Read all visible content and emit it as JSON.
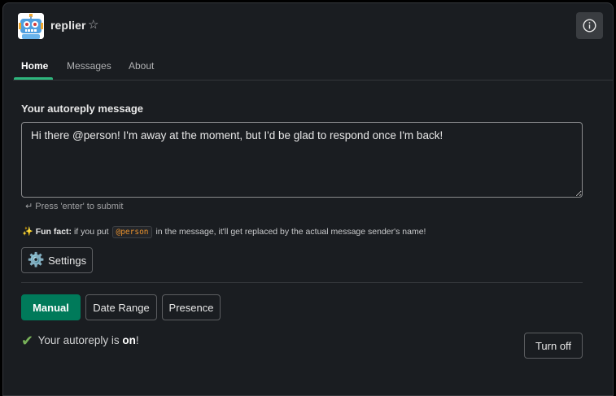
{
  "app": {
    "name": "replier",
    "avatar_icon": "robot-icon",
    "star_icon": "☆",
    "info_icon": "info-icon"
  },
  "tabs": [
    {
      "label": "Home",
      "active": true
    },
    {
      "label": "Messages",
      "active": false
    },
    {
      "label": "About",
      "active": false
    }
  ],
  "autoreply": {
    "section_label": "Your autoreply message",
    "message_value": "Hi there @person! I'm away at the moment, but I'd be glad to respond once I'm back!",
    "submit_hint": "↵ Press 'enter' to submit"
  },
  "fun_fact": {
    "icon": "✨",
    "label": "Fun fact:",
    "text_before": " if you put ",
    "code": "@person",
    "text_after": " in the message, it'll get replaced by the actual message sender's name!"
  },
  "settings": {
    "icon": "⚙️",
    "label": "Settings"
  },
  "modes": {
    "manual_label": "Manual",
    "date_range_label": "Date Range",
    "presence_label": "Presence",
    "selected": "Manual"
  },
  "status": {
    "check_icon": "✔",
    "text_before": " Your autoreply is ",
    "state": "on",
    "text_after": "!",
    "turn_off_label": "Turn off"
  },
  "colors": {
    "background": "#1a1d21",
    "accent_green": "#007a5a",
    "tab_underline": "#2eb67d",
    "code_text": "#e8912d"
  }
}
